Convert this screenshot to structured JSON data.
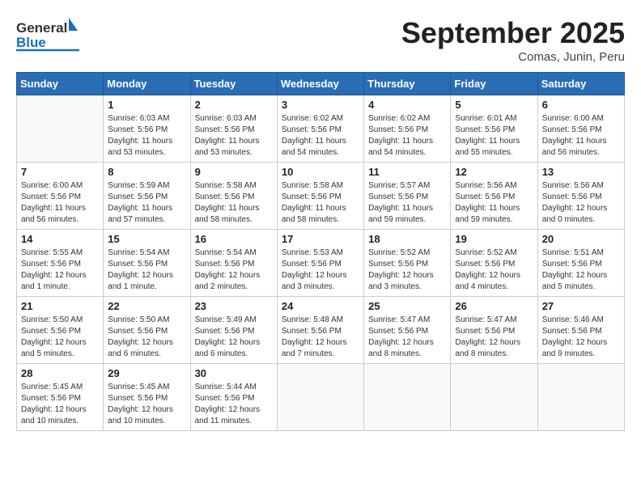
{
  "logo": {
    "general": "General",
    "blue": "Blue"
  },
  "title": "September 2025",
  "subtitle": "Comas, Junin, Peru",
  "days_of_week": [
    "Sunday",
    "Monday",
    "Tuesday",
    "Wednesday",
    "Thursday",
    "Friday",
    "Saturday"
  ],
  "weeks": [
    [
      {
        "day": "",
        "info": ""
      },
      {
        "day": "1",
        "info": "Sunrise: 6:03 AM\nSunset: 5:56 PM\nDaylight: 11 hours\nand 53 minutes."
      },
      {
        "day": "2",
        "info": "Sunrise: 6:03 AM\nSunset: 5:56 PM\nDaylight: 11 hours\nand 53 minutes."
      },
      {
        "day": "3",
        "info": "Sunrise: 6:02 AM\nSunset: 5:56 PM\nDaylight: 11 hours\nand 54 minutes."
      },
      {
        "day": "4",
        "info": "Sunrise: 6:02 AM\nSunset: 5:56 PM\nDaylight: 11 hours\nand 54 minutes."
      },
      {
        "day": "5",
        "info": "Sunrise: 6:01 AM\nSunset: 5:56 PM\nDaylight: 11 hours\nand 55 minutes."
      },
      {
        "day": "6",
        "info": "Sunrise: 6:00 AM\nSunset: 5:56 PM\nDaylight: 11 hours\nand 56 minutes."
      }
    ],
    [
      {
        "day": "7",
        "info": "Sunrise: 6:00 AM\nSunset: 5:56 PM\nDaylight: 11 hours\nand 56 minutes."
      },
      {
        "day": "8",
        "info": "Sunrise: 5:59 AM\nSunset: 5:56 PM\nDaylight: 11 hours\nand 57 minutes."
      },
      {
        "day": "9",
        "info": "Sunrise: 5:58 AM\nSunset: 5:56 PM\nDaylight: 11 hours\nand 58 minutes."
      },
      {
        "day": "10",
        "info": "Sunrise: 5:58 AM\nSunset: 5:56 PM\nDaylight: 11 hours\nand 58 minutes."
      },
      {
        "day": "11",
        "info": "Sunrise: 5:57 AM\nSunset: 5:56 PM\nDaylight: 11 hours\nand 59 minutes."
      },
      {
        "day": "12",
        "info": "Sunrise: 5:56 AM\nSunset: 5:56 PM\nDaylight: 11 hours\nand 59 minutes."
      },
      {
        "day": "13",
        "info": "Sunrise: 5:56 AM\nSunset: 5:56 PM\nDaylight: 12 hours\nand 0 minutes."
      }
    ],
    [
      {
        "day": "14",
        "info": "Sunrise: 5:55 AM\nSunset: 5:56 PM\nDaylight: 12 hours\nand 1 minute."
      },
      {
        "day": "15",
        "info": "Sunrise: 5:54 AM\nSunset: 5:56 PM\nDaylight: 12 hours\nand 1 minute."
      },
      {
        "day": "16",
        "info": "Sunrise: 5:54 AM\nSunset: 5:56 PM\nDaylight: 12 hours\nand 2 minutes."
      },
      {
        "day": "17",
        "info": "Sunrise: 5:53 AM\nSunset: 5:56 PM\nDaylight: 12 hours\nand 3 minutes."
      },
      {
        "day": "18",
        "info": "Sunrise: 5:52 AM\nSunset: 5:56 PM\nDaylight: 12 hours\nand 3 minutes."
      },
      {
        "day": "19",
        "info": "Sunrise: 5:52 AM\nSunset: 5:56 PM\nDaylight: 12 hours\nand 4 minutes."
      },
      {
        "day": "20",
        "info": "Sunrise: 5:51 AM\nSunset: 5:56 PM\nDaylight: 12 hours\nand 5 minutes."
      }
    ],
    [
      {
        "day": "21",
        "info": "Sunrise: 5:50 AM\nSunset: 5:56 PM\nDaylight: 12 hours\nand 5 minutes."
      },
      {
        "day": "22",
        "info": "Sunrise: 5:50 AM\nSunset: 5:56 PM\nDaylight: 12 hours\nand 6 minutes."
      },
      {
        "day": "23",
        "info": "Sunrise: 5:49 AM\nSunset: 5:56 PM\nDaylight: 12 hours\nand 6 minutes."
      },
      {
        "day": "24",
        "info": "Sunrise: 5:48 AM\nSunset: 5:56 PM\nDaylight: 12 hours\nand 7 minutes."
      },
      {
        "day": "25",
        "info": "Sunrise: 5:47 AM\nSunset: 5:56 PM\nDaylight: 12 hours\nand 8 minutes."
      },
      {
        "day": "26",
        "info": "Sunrise: 5:47 AM\nSunset: 5:56 PM\nDaylight: 12 hours\nand 8 minutes."
      },
      {
        "day": "27",
        "info": "Sunrise: 5:46 AM\nSunset: 5:56 PM\nDaylight: 12 hours\nand 9 minutes."
      }
    ],
    [
      {
        "day": "28",
        "info": "Sunrise: 5:45 AM\nSunset: 5:56 PM\nDaylight: 12 hours\nand 10 minutes."
      },
      {
        "day": "29",
        "info": "Sunrise: 5:45 AM\nSunset: 5:56 PM\nDaylight: 12 hours\nand 10 minutes."
      },
      {
        "day": "30",
        "info": "Sunrise: 5:44 AM\nSunset: 5:56 PM\nDaylight: 12 hours\nand 11 minutes."
      },
      {
        "day": "",
        "info": ""
      },
      {
        "day": "",
        "info": ""
      },
      {
        "day": "",
        "info": ""
      },
      {
        "day": "",
        "info": ""
      }
    ]
  ]
}
